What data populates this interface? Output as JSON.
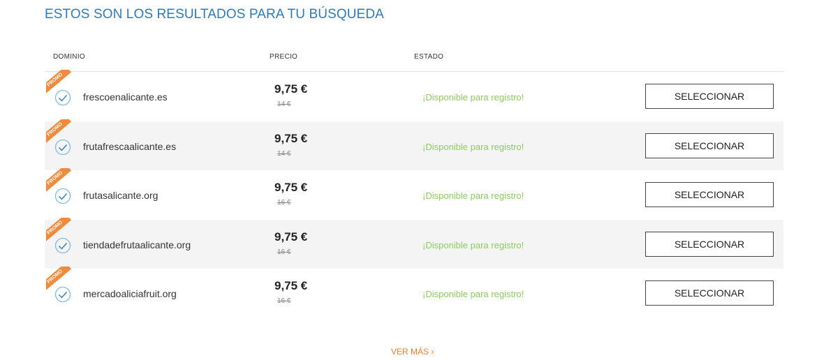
{
  "title": "ESTOS SON LOS RESULTADOS PARA TU BÚSQUEDA",
  "columns": {
    "domain": "DOMINIO",
    "price": "PRECIO",
    "status": "ESTADO"
  },
  "promo_label": "PROMO",
  "select_label": "SELECCIONAR",
  "results": [
    {
      "domain": "frescoenalicante.es",
      "price": "9,75 €",
      "old_price": "14 €",
      "status": "¡Disponible para registro!"
    },
    {
      "domain": "frutafrescaalicante.es",
      "price": "9,75 €",
      "old_price": "14 €",
      "status": "¡Disponible para registro!"
    },
    {
      "domain": "frutasalicante.org",
      "price": "9,75 €",
      "old_price": "16 €",
      "status": "¡Disponible para registro!"
    },
    {
      "domain": "tiendadefrutaalicante.org",
      "price": "9,75 €",
      "old_price": "16 €",
      "status": "¡Disponible para registro!"
    },
    {
      "domain": "mercadoaliciafruit.org",
      "price": "9,75 €",
      "old_price": "16 €",
      "status": "¡Disponible para registro!"
    }
  ],
  "more_link": "VER MÁS ›",
  "colors": {
    "accent": "#2f7ab8",
    "available": "#8ccb5e",
    "promo": "#f08a3c",
    "link": "#f07b2e"
  }
}
